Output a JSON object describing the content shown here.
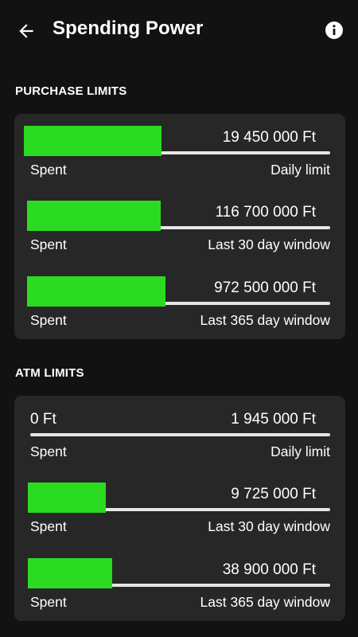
{
  "header": {
    "title": "Spending Power",
    "back_icon": "arrow-left-icon",
    "info_icon": "info-icon"
  },
  "colors": {
    "background": "#121212",
    "card": "#272727",
    "progress_fill": "#2bdb21",
    "track": "#e6e6e6"
  },
  "purchase_limits": {
    "heading": "PURCHASE LIMITS",
    "rows": [
      {
        "spent_label": "Spent",
        "limit_amount": "19 450 000 Ft",
        "period": "Daily limit",
        "spent_fraction": 0.45
      },
      {
        "spent_label": "Spent",
        "limit_amount": "116 700 000 Ft",
        "period": "Last 30 day window",
        "spent_fraction": 0.44
      },
      {
        "spent_label": "Spent",
        "limit_amount": "972 500 000 Ft",
        "period": "Last 365 day window",
        "spent_fraction": 0.46
      }
    ]
  },
  "atm_limits": {
    "heading": "ATM LIMITS",
    "rows": [
      {
        "spent_label": "Spent",
        "spent_amount": "0 Ft",
        "limit_amount": "1 945 000 Ft",
        "period": "Daily limit",
        "spent_fraction": 0
      },
      {
        "spent_label": "Spent",
        "limit_amount": "9 725 000 Ft",
        "period": "Last 30 day window",
        "spent_fraction": 0.26
      },
      {
        "spent_label": "Spent",
        "limit_amount": "38 900 000 Ft",
        "period": "Last 365 day window",
        "spent_fraction": 0.28
      }
    ]
  }
}
